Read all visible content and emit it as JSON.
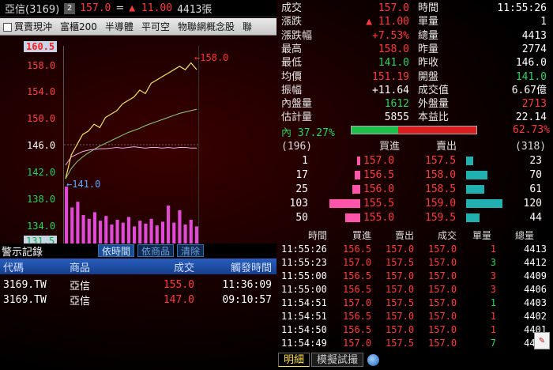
{
  "header": {
    "stock": "亞信(3169)",
    "badge": "2",
    "price": "157.0",
    "price_mark": "=",
    "change": "▲ 11.00",
    "volume": "4413張"
  },
  "toolbar": {
    "items": [
      "買賣現沖",
      "富櫃200",
      "半導體",
      "平可空",
      "物聯網概念股",
      "聯"
    ]
  },
  "chart": {
    "y_ticks": [
      "160.5",
      "158.0",
      "154.0",
      "150.0",
      "146.0",
      "142.0",
      "138.0",
      "134.0",
      "131.5"
    ],
    "high_tag": "←158.0",
    "low_tag": "←141.0"
  },
  "chart_data": {
    "type": "line",
    "ylim": [
      131.5,
      160.5
    ],
    "reference": 146.0,
    "series": [
      {
        "values": [
          141.0,
          144.5,
          146.0,
          147.5,
          148.0,
          149.0,
          148.5,
          150.0,
          150.5,
          151.0,
          152.0,
          152.5,
          153.0,
          154.0,
          153.5,
          155.0,
          155.5,
          156.0,
          156.5,
          157.0,
          157.5,
          157.0,
          158.0,
          157.0
        ]
      },
      {
        "values": [
          141.0,
          142.5,
          143.5,
          144.2,
          144.8,
          145.3,
          145.8,
          146.2,
          146.6,
          147.0,
          147.4,
          147.8,
          148.1,
          148.4,
          148.8,
          149.1,
          149.4,
          149.7,
          150.0,
          150.3,
          150.6,
          150.8,
          151.0,
          151.2
        ]
      },
      {
        "values": [
          143.0,
          144.2,
          144.6,
          145.0,
          145.2,
          145.3,
          145.4,
          145.4,
          145.5,
          145.6,
          145.5,
          145.6,
          145.7,
          145.6,
          145.5,
          145.6,
          145.6,
          145.5,
          145.6,
          145.5,
          145.6,
          145.6,
          145.5,
          145.5
        ]
      }
    ],
    "volume": [
      60,
      38,
      44,
      30,
      26,
      33,
      24,
      29,
      20,
      25,
      22,
      28,
      18,
      24,
      21,
      26,
      19,
      23,
      40,
      22,
      35,
      20,
      25,
      18
    ]
  },
  "alerts": {
    "title": "警示記錄",
    "tabs": [
      "依時間",
      "依商品",
      "清除"
    ],
    "columns": [
      "代碼",
      "商品",
      "成交",
      "觸發時間"
    ],
    "rows": [
      {
        "code": "3169.TW",
        "name": "亞信",
        "price": "155.0",
        "time": "11:36:09"
      },
      {
        "code": "3169.TW",
        "name": "亞信",
        "price": "147.0",
        "time": "09:10:57"
      }
    ]
  },
  "quote": {
    "rows": [
      {
        "l": "成交",
        "lv": "157.0",
        "lc": "red",
        "r": "時間",
        "rv": "11:55:26",
        "rc": "white"
      },
      {
        "l": "漲跌",
        "lv": "▲ 11.00",
        "lc": "red",
        "r": "單量",
        "rv": "1",
        "rc": "white"
      },
      {
        "l": "漲跌幅",
        "lv": "+7.53%",
        "lc": "red",
        "r": "總量",
        "rv": "4413",
        "rc": "white"
      },
      {
        "l": "最高",
        "lv": "158.0",
        "lc": "red",
        "r": "昨量",
        "rv": "2774",
        "rc": "white"
      },
      {
        "l": "最低",
        "lv": "141.0",
        "lc": "green",
        "r": "昨收",
        "rv": "146.0",
        "rc": "white"
      },
      {
        "l": "均價",
        "lv": "151.19",
        "lc": "red",
        "r": "開盤",
        "rv": "141.0",
        "rc": "green"
      },
      {
        "l": "振幅",
        "lv": "+11.64",
        "lc": "white",
        "r": "成交值",
        "rv": "6.67億",
        "rc": "white"
      },
      {
        "l": "內盤量",
        "lv": "1612",
        "lc": "green",
        "r": "外盤量",
        "rv": "2713",
        "rc": "red"
      },
      {
        "l": "估計量",
        "lv": "5855",
        "lc": "white",
        "r": "本益比",
        "rv": "22.14",
        "rc": "white"
      }
    ],
    "inner_ratio": "內 37.27%",
    "outer_ratio": "62.73%",
    "inner_fraction": 0.3727
  },
  "book": {
    "total_bid": "(196)",
    "total_ask": "(318)",
    "bid_label": "買進",
    "ask_label": "賣出",
    "rows": [
      {
        "bq": "1",
        "bp": "157.0",
        "ap": "157.5",
        "aq": "23"
      },
      {
        "bq": "17",
        "bp": "156.5",
        "ap": "158.0",
        "aq": "70"
      },
      {
        "bq": "25",
        "bp": "156.0",
        "ap": "158.5",
        "aq": "61"
      },
      {
        "bq": "103",
        "bp": "155.5",
        "ap": "159.0",
        "aq": "120"
      },
      {
        "bq": "50",
        "bp": "155.0",
        "ap": "159.5",
        "aq": "44"
      }
    ]
  },
  "trades": {
    "columns": [
      "時間",
      "買進",
      "賣出",
      "成交",
      "單量",
      "總量"
    ],
    "rows": [
      {
        "t": "11:55:26",
        "b": "156.5",
        "s": "157.0",
        "p": "157.0",
        "q": "1",
        "v": "4413",
        "qc": "red"
      },
      {
        "t": "11:55:23",
        "b": "157.0",
        "s": "157.5",
        "p": "157.0",
        "q": "3",
        "v": "4412",
        "qc": "green"
      },
      {
        "t": "11:55:00",
        "b": "156.5",
        "s": "157.0",
        "p": "157.0",
        "q": "3",
        "v": "4409",
        "qc": "red"
      },
      {
        "t": "11:55:00",
        "b": "156.5",
        "s": "157.0",
        "p": "157.0",
        "q": "3",
        "v": "4406",
        "qc": "red"
      },
      {
        "t": "11:54:51",
        "b": "157.0",
        "s": "157.5",
        "p": "157.0",
        "q": "1",
        "v": "4403",
        "qc": "green"
      },
      {
        "t": "11:54:51",
        "b": "156.5",
        "s": "157.0",
        "p": "157.0",
        "q": "1",
        "v": "4402",
        "qc": "red"
      },
      {
        "t": "11:54:50",
        "b": "156.5",
        "s": "157.0",
        "p": "157.0",
        "q": "1",
        "v": "4401",
        "qc": "red"
      },
      {
        "t": "11:54:49",
        "b": "157.0",
        "s": "157.5",
        "p": "157.0",
        "q": "7",
        "v": "4400",
        "qc": "green"
      }
    ]
  },
  "bottom_tabs": [
    "明細",
    "模擬試撮"
  ],
  "colors": {
    "up": "#ff3b3b",
    "down": "#2bd45a",
    "bid_bar": "#ff55aa",
    "ask_bar": "#21b0b0"
  }
}
